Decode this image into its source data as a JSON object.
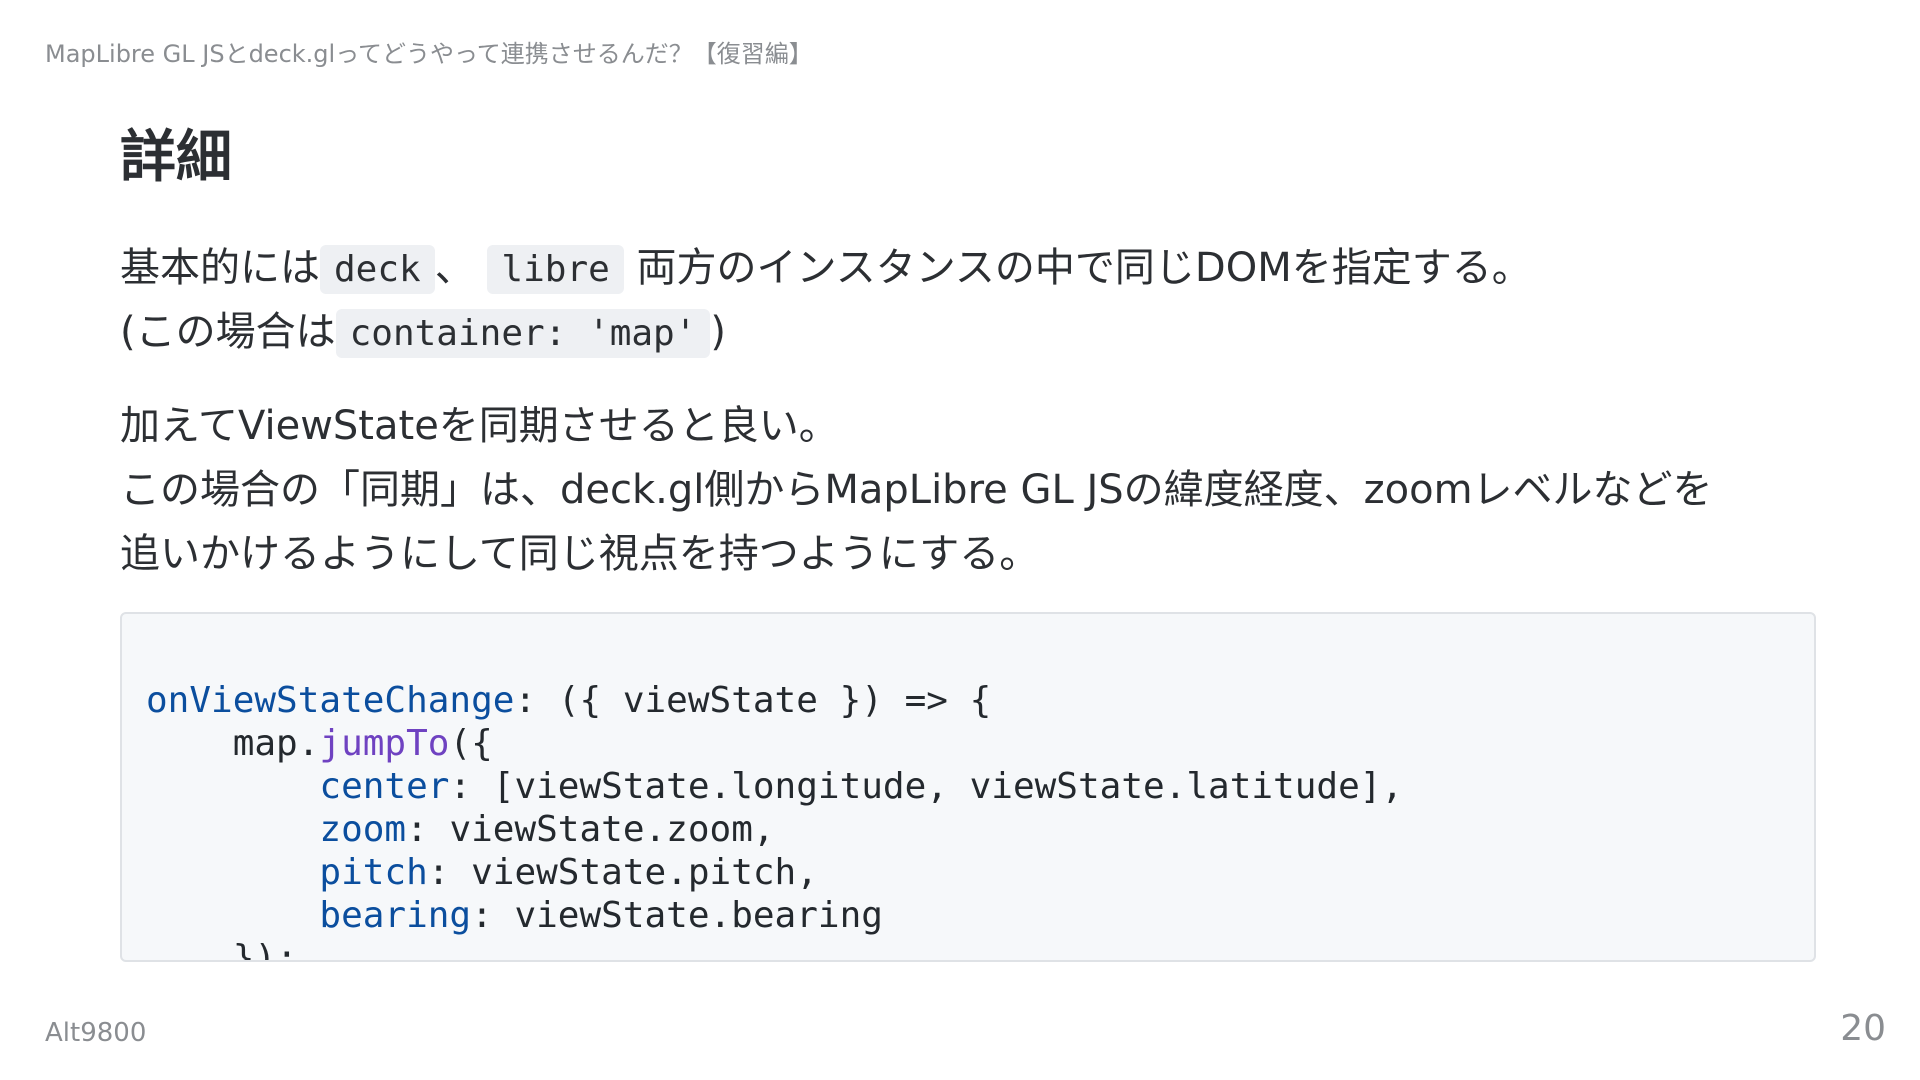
{
  "header": {
    "deck_title": "MapLibre GL JSとdeck.glってどうやって連携させるんだ？【復習編】"
  },
  "slide": {
    "title": "詳細",
    "paragraph1": {
      "line1": {
        "t1": "基本的には",
        "c1": "deck",
        "t2": "、",
        "c2": "libre",
        "t3": "両方のインスタンスの中で同じDOMを指定する。"
      },
      "line2": {
        "t1": "(この場合は",
        "c1": "container: 'map'",
        "t2": ")"
      }
    },
    "paragraph2": {
      "line1": "加えてViewStateを同期させると良い。",
      "line2": "この場合の「同期」は、deck.gl側からMapLibre GL JSの緯度経度、zoomレベルなどを",
      "line3": "追いかけるようにして同じ視点を持つようにする。"
    }
  },
  "code_block": {
    "lines": [
      [
        {
          "text": "onViewStateChange",
          "kind": "prop"
        },
        {
          "text": ": ({ viewState }) => {",
          "kind": "plain"
        }
      ],
      [
        {
          "text": "    map.",
          "kind": "plain"
        },
        {
          "text": "jumpTo",
          "kind": "fn"
        },
        {
          "text": "({",
          "kind": "plain"
        }
      ],
      [
        {
          "text": "        ",
          "kind": "plain"
        },
        {
          "text": "center",
          "kind": "prop"
        },
        {
          "text": ": [viewState.longitude, viewState.latitude],",
          "kind": "plain"
        }
      ],
      [
        {
          "text": "        ",
          "kind": "plain"
        },
        {
          "text": "zoom",
          "kind": "prop"
        },
        {
          "text": ": viewState.zoom,",
          "kind": "plain"
        }
      ],
      [
        {
          "text": "        ",
          "kind": "plain"
        },
        {
          "text": "pitch",
          "kind": "prop"
        },
        {
          "text": ": viewState.pitch,",
          "kind": "plain"
        }
      ],
      [
        {
          "text": "        ",
          "kind": "plain"
        },
        {
          "text": "bearing",
          "kind": "prop"
        },
        {
          "text": ": viewState.bearing",
          "kind": "plain"
        }
      ],
      [
        {
          "text": "    });",
          "kind": "plain"
        }
      ]
    ]
  },
  "footer": {
    "author": "Alt9800",
    "page_number": "20"
  },
  "colors": {
    "text": "#2c2f33",
    "muted": "#8a8d91",
    "code_property": "#0b4e9e",
    "code_function": "#6f42c1",
    "code_background": "#f6f8fa",
    "inline_code_background": "#eef0f3"
  }
}
